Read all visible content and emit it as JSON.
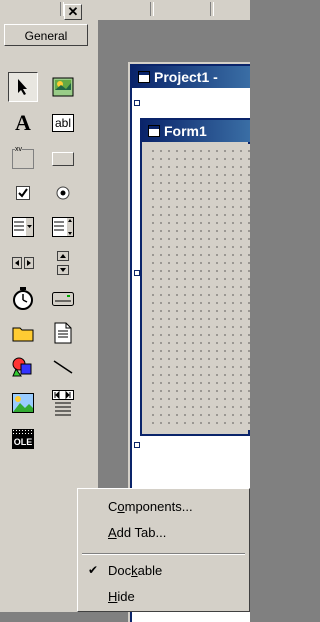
{
  "toolbox": {
    "close_glyph": "✕",
    "tab_label": "General",
    "tools": [
      "pointer-icon",
      "picturebox-icon",
      "label-icon",
      "textbox-icon",
      "frame-icon",
      "commandbutton-icon",
      "checkbox-icon",
      "optionbutton-icon",
      "combobox-icon",
      "listbox-icon",
      "hscrollbar-icon",
      "vscrollbar-icon",
      "timer-icon",
      "drivelistbox-icon",
      "dirlistbox-icon",
      "filelistbox-icon",
      "shape-icon",
      "line-icon",
      "image-icon",
      "data-icon",
      "ole-icon"
    ],
    "label_tool_glyph": "A",
    "textbox_tool_text": "abl",
    "frame_tool_text": "xv",
    "ole_tool_text": "OLE"
  },
  "project_window": {
    "title": "Project1 -"
  },
  "form_window": {
    "title": "Form1"
  },
  "context_menu": {
    "items": [
      {
        "before": "C",
        "ul": "o",
        "after": "mponents..."
      },
      {
        "before": "",
        "ul": "A",
        "after": "dd Tab..."
      },
      {
        "before": "Doc",
        "ul": "k",
        "after": "able"
      },
      {
        "before": "",
        "ul": "H",
        "after": "ide"
      }
    ],
    "dockable_checked_glyph": "✔"
  },
  "colors": {
    "titlebar": "#0a246a",
    "face": "#d4d0c8",
    "desktop": "#808080"
  }
}
